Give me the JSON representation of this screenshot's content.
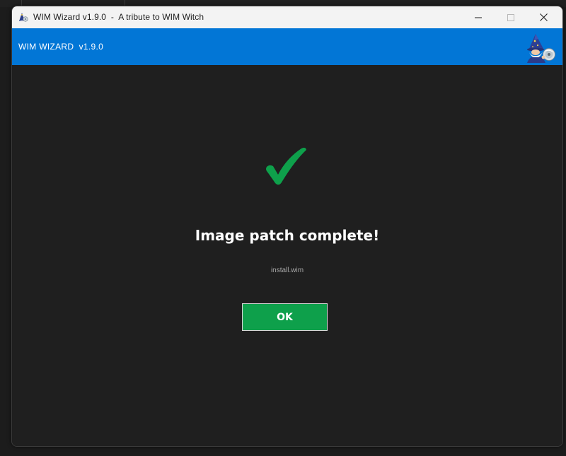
{
  "window": {
    "title": "WIM Wizard v1.9.0  -  A tribute to WIM Witch",
    "icon": "wizard-icon",
    "controls": [
      "minimize-icon",
      "maximize-icon",
      "close-icon"
    ]
  },
  "header": {
    "title": "WIM WIZARD  v1.9.0",
    "logo": "wizard-logo",
    "background": "#0276d6"
  },
  "main": {
    "status_icon": "checkmark-icon",
    "status_color": "#0ea04b",
    "message": "Image patch complete!",
    "detail": "install.wim",
    "ok_label": "OK"
  }
}
